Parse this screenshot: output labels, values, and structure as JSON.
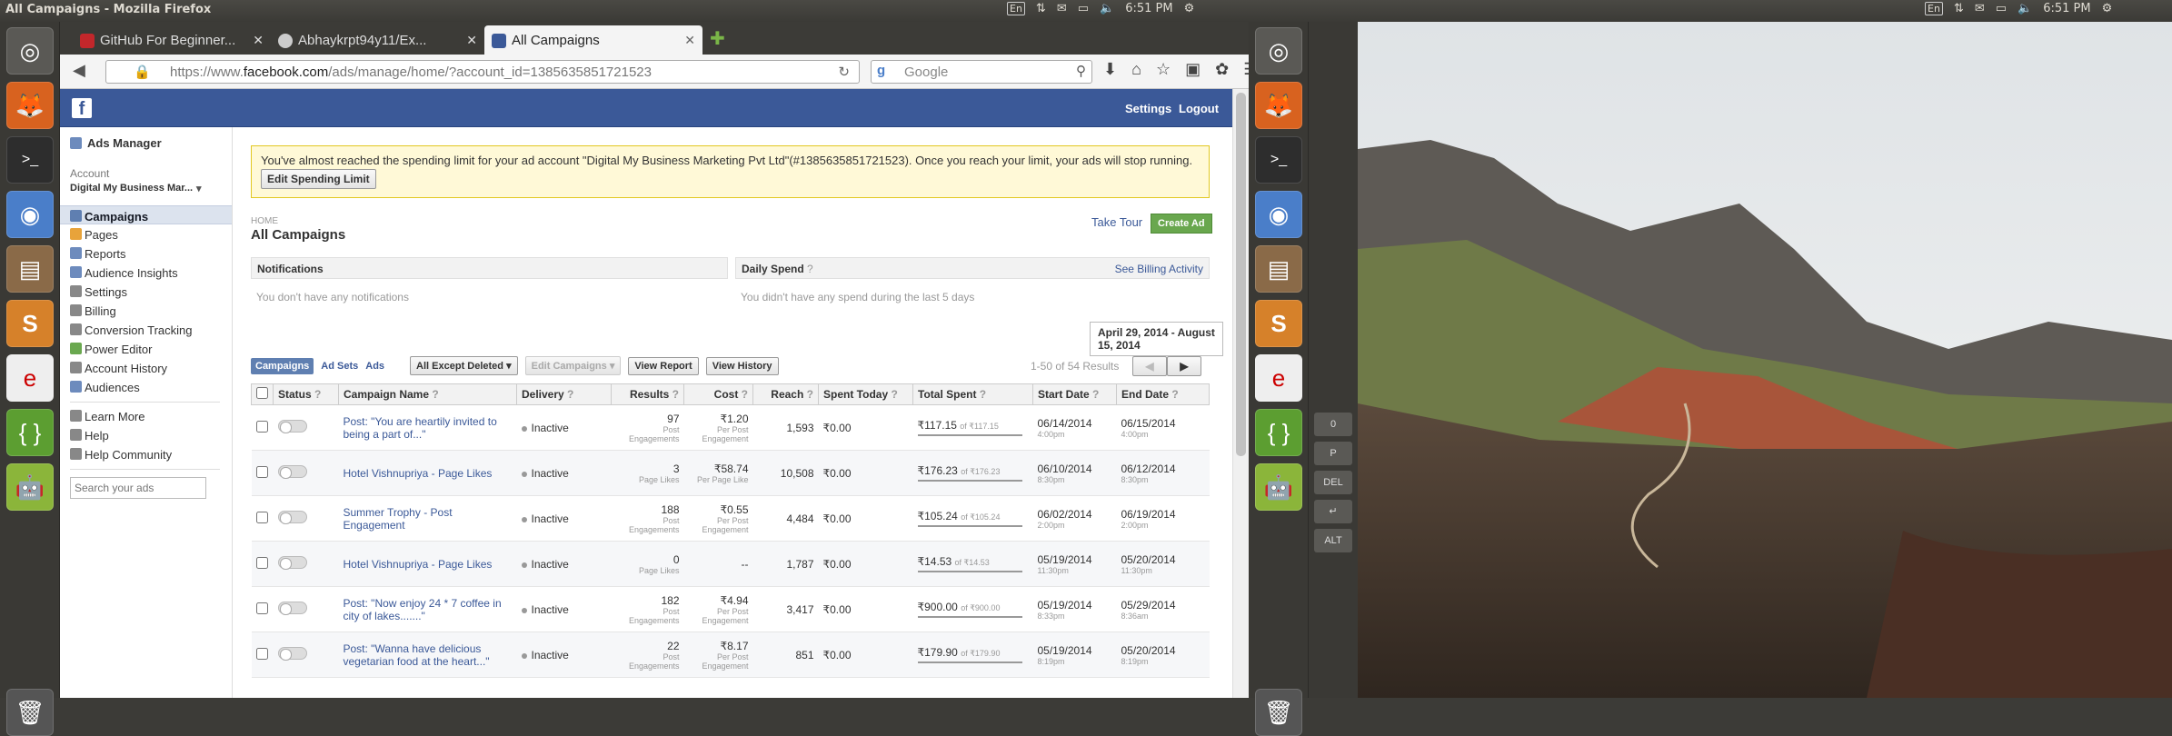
{
  "window_title": "All Campaigns - Mozilla Firefox",
  "tray": {
    "keyboard": "En",
    "time": "6:51 PM"
  },
  "tabs": [
    {
      "label": "GitHub For Beginner...",
      "icon": "github-for-beginners-icon",
      "active": false
    },
    {
      "label": "Abhaykrpt94y11/Ex...",
      "icon": "github-icon",
      "active": false
    },
    {
      "label": "All Campaigns",
      "icon": "facebook-icon",
      "active": true
    }
  ],
  "url": {
    "prefix": "https://www.",
    "domain": "facebook.com",
    "path": "/ads/manage/home/?account_id=1385635851721523"
  },
  "search_placeholder": "Google",
  "fb_header": {
    "settings": "Settings",
    "logout": "Logout"
  },
  "sidebar": {
    "title": "Ads Manager",
    "account_label": "Account",
    "account_name": "Digital My Business Mar...",
    "items": [
      {
        "label": "Campaigns",
        "active": true,
        "color": "#5f7fb1"
      },
      {
        "label": "Pages",
        "color": "#e8a33a"
      },
      {
        "label": "Reports",
        "color": "#6d8bbd"
      },
      {
        "label": "Audience Insights",
        "color": "#6d8bbd"
      },
      {
        "label": "Settings",
        "color": "#888"
      },
      {
        "label": "Billing",
        "color": "#888"
      },
      {
        "label": "Conversion Tracking",
        "color": "#888"
      },
      {
        "label": "Power Editor",
        "color": "#6aa84f"
      },
      {
        "label": "Account History",
        "color": "#888"
      },
      {
        "label": "Audiences",
        "color": "#6d8bbd"
      }
    ],
    "help_items": [
      {
        "label": "Learn More"
      },
      {
        "label": "Help"
      },
      {
        "label": "Help Community"
      }
    ],
    "search_placeholder": "Search your ads"
  },
  "warning": {
    "text": "You've almost reached the spending limit for your ad account \"Digital My Business Marketing Pvt Ltd\"(#1385635851721523). Once you reach your limit, your ads will stop running.",
    "button": "Edit Spending Limit"
  },
  "breadcrumb": "HOME",
  "page_title": "All Campaigns",
  "take_tour": "Take Tour",
  "create_ad": "Create Ad",
  "notifications": {
    "title": "Notifications",
    "empty": "You don't have any notifications"
  },
  "daily_spend": {
    "title": "Daily Spend",
    "link": "See Billing Activity",
    "empty": "You didn't have any spend during the last 5 days"
  },
  "date_range": "April 29, 2014 - August 15, 2014",
  "view_tabs": {
    "campaigns": "Campaigns",
    "ad_sets": "Ad Sets",
    "ads": "Ads"
  },
  "filter": "All Except Deleted",
  "edit_campaigns": "Edit Campaigns",
  "view_report": "View Report",
  "view_history": "View History",
  "results_count": "1-50 of 54 Results",
  "columns": [
    "Status",
    "Campaign Name",
    "Delivery",
    "Results",
    "Cost",
    "Reach",
    "Spent Today",
    "Total Spent",
    "Start Date",
    "End Date"
  ],
  "rows": [
    {
      "name": "Post: \"You are heartily invited to being a part of...\"",
      "delivery": "Inactive",
      "results": "97",
      "results_sub": "Post Engagements",
      "cost": "₹1.20",
      "cost_sub": "Per Post Engagement",
      "reach": "1,593",
      "spent_today": "₹0.00",
      "total": "₹117.15",
      "total_of": "of ₹117.15",
      "start": "06/14/2014",
      "start_time": "4:00pm",
      "end": "06/15/2014",
      "end_time": "4:00pm"
    },
    {
      "name": "Hotel Vishnupriya - Page Likes",
      "delivery": "Inactive",
      "results": "3",
      "results_sub": "Page Likes",
      "cost": "₹58.74",
      "cost_sub": "Per Page Like",
      "reach": "10,508",
      "spent_today": "₹0.00",
      "total": "₹176.23",
      "total_of": "of ₹176.23",
      "start": "06/10/2014",
      "start_time": "8:30pm",
      "end": "06/12/2014",
      "end_time": "8:30pm"
    },
    {
      "name": "Summer Trophy - Post Engagement",
      "delivery": "Inactive",
      "results": "188",
      "results_sub": "Post Engagements",
      "cost": "₹0.55",
      "cost_sub": "Per Post Engagement",
      "reach": "4,484",
      "spent_today": "₹0.00",
      "total": "₹105.24",
      "total_of": "of ₹105.24",
      "start": "06/02/2014",
      "start_time": "2:00pm",
      "end": "06/19/2014",
      "end_time": "2:00pm"
    },
    {
      "name": "Hotel Vishnupriya - Page Likes",
      "delivery": "Inactive",
      "results": "0",
      "results_sub": "Page Likes",
      "cost": "--",
      "cost_sub": "",
      "reach": "1,787",
      "spent_today": "₹0.00",
      "total": "₹14.53",
      "total_of": "of ₹14.53",
      "start": "05/19/2014",
      "start_time": "11:30pm",
      "end": "05/20/2014",
      "end_time": "11:30pm"
    },
    {
      "name": "Post: \"Now enjoy 24 * 7 coffee in city of lakes.......\"",
      "delivery": "Inactive",
      "results": "182",
      "results_sub": "Post Engagements",
      "cost": "₹4.94",
      "cost_sub": "Per Post Engagement",
      "reach": "3,417",
      "spent_today": "₹0.00",
      "total": "₹900.00",
      "total_of": "of ₹900.00",
      "start": "05/19/2014",
      "start_time": "8:33pm",
      "end": "05/29/2014",
      "end_time": "8:36am"
    },
    {
      "name": "Post: \"Wanna have delicious vegetarian food at the heart...\"",
      "delivery": "Inactive",
      "results": "22",
      "results_sub": "Post Engagements",
      "cost": "₹8.17",
      "cost_sub": "Per Post Engagement",
      "reach": "851",
      "spent_today": "₹0.00",
      "total": "₹179.90",
      "total_of": "of ₹179.90",
      "start": "05/19/2014",
      "start_time": "8:19pm",
      "end": "05/20/2014",
      "end_time": "8:19pm"
    }
  ],
  "keypad": [
    "0",
    "P",
    "DEL",
    "↵",
    "ALT"
  ],
  "colors": {
    "fb_blue": "#3b5998",
    "create_green": "#69a74e",
    "warning_bg": "#fff9d7",
    "launcher_bg": "#3a3935"
  }
}
